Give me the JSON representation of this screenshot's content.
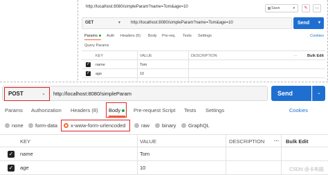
{
  "top": {
    "url": "http://localhost:8080/simpleParam?name=Tom&age=10",
    "save_label": "Save",
    "method": "GET",
    "request_url": "http://localhost:8080/simpleParam?name=Tom&age=10",
    "send_label": "Send",
    "tabs": [
      "Params",
      "Auth",
      "Headers (6)",
      "Body",
      "Pre-req.",
      "Tests",
      "Settings"
    ],
    "cookies_label": "Cookies",
    "query_params_label": "Query Params",
    "table": {
      "headers": {
        "key": "KEY",
        "value": "VALUE",
        "description": "DESCRIPTION",
        "more": "···",
        "bulk": "Bulk Edit"
      },
      "rows": [
        {
          "key": "name",
          "value": "Tom"
        },
        {
          "key": "age",
          "value": "10"
        }
      ]
    }
  },
  "bottom": {
    "method": "POST",
    "request_url": "http://localhost:8080/simpleParam",
    "send_label": "Send",
    "tabs": [
      "Params",
      "Authorization",
      "Headers (8)",
      "Body",
      "Pre-request Script",
      "Tests",
      "Settings"
    ],
    "cookies_label": "Cookies",
    "body_types": [
      "none",
      "form-data",
      "x-www-form-urlencoded",
      "raw",
      "binary",
      "GraphQL"
    ],
    "selected_body_type": "x-www-form-urlencoded",
    "table": {
      "headers": {
        "key": "KEY",
        "value": "VALUE",
        "description": "DESCRIPTION",
        "more": "···",
        "bulk": "Bulk Edit"
      },
      "rows": [
        {
          "key": "name",
          "value": "Tom"
        },
        {
          "key": "age",
          "value": "10"
        }
      ]
    }
  },
  "watermark": "CSDN @卡布路",
  "colors": {
    "accent": "#f26b3a",
    "send": "#1f6fd1",
    "highlight": "#d92323",
    "active_dot": "#1aa34a"
  }
}
